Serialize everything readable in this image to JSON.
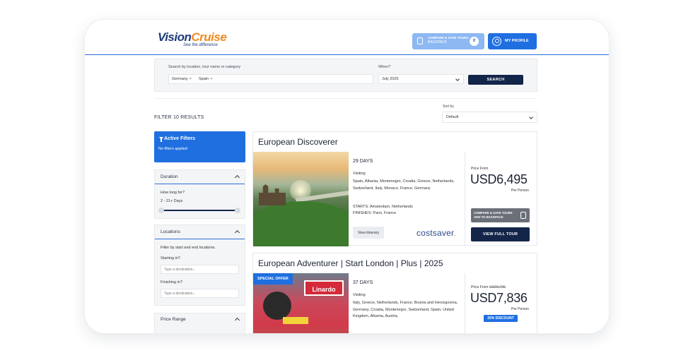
{
  "header": {
    "logo_main_1": "Vision",
    "logo_main_2": "Cruise",
    "logo_tagline": "See the difference",
    "backpack_line1": "COMPARE & SAVE TOURS",
    "backpack_line2": "BACKPACK",
    "backpack_count": "0",
    "profile_label": "MY PROFILE"
  },
  "search": {
    "location_label": "Search by location, tour name or category",
    "chips": [
      {
        "label": "Germany"
      },
      {
        "label": "Spain"
      }
    ],
    "when_label": "When?",
    "when_value": "July 2025",
    "button_label": "SEARCH"
  },
  "results": {
    "filter_count": "FILTER 10 RESULTS",
    "sort_label": "Sort by",
    "sort_value": "Default"
  },
  "filters": {
    "active_title": "Active Filters",
    "active_sub": "No filters applied",
    "duration": {
      "title": "Duration",
      "question": "How long for?",
      "range": "2 - 21+ Days"
    },
    "locations": {
      "title": "Locations",
      "hint": "Filter by start and end locations.",
      "start_label": "Starting in?",
      "start_placeholder": "Type a destination...",
      "finish_label": "Finishing in?",
      "finish_placeholder": "Type a destination..."
    },
    "price_range": {
      "title": "Price Range"
    }
  },
  "tours": [
    {
      "title": "European Discoverer",
      "days": "29 DAYS",
      "visiting_label": "Visiting",
      "visiting": "Spain, Albania, Montenegro, Croatia, Greece, Netherlands, Switzerland, Italy, Monaco, France, Germany",
      "starts": "STARTS: Amsterdam, Netherlands",
      "finishes": "FINISHES: Paris, France",
      "itinerary_label": "View itinerary",
      "brand": "costsaver",
      "price_from": "Price From",
      "price": "USD6,495",
      "per_person": "Per Person",
      "compare_line1": "COMPARE & SAVE TOURS",
      "compare_line2": "ADD TO BACKPACK",
      "view_label": "VIEW FULL TOUR"
    },
    {
      "title": "European Adventurer | Start London | Plus | 2025",
      "badge": "SPECIAL OFFER",
      "sign_text": "Linardo",
      "days": "37 DAYS",
      "visiting_label": "Visiting",
      "visiting": "Italy, Greece, Netherlands, France, Bosnia and Herzegovina, Germany, Croatia, Montenegro, Switzerland, Spain, United Kingdom, Albania, Austria,",
      "price_from": "Price From",
      "price_old": "USD9,795",
      "price": "USD7,836",
      "per_person": "Per Person",
      "discount": "20% DISCOUNT"
    }
  ],
  "colors": {
    "primary": "#1f6fe0",
    "navy": "#14254a",
    "logo_orange": "#f08a1c"
  }
}
